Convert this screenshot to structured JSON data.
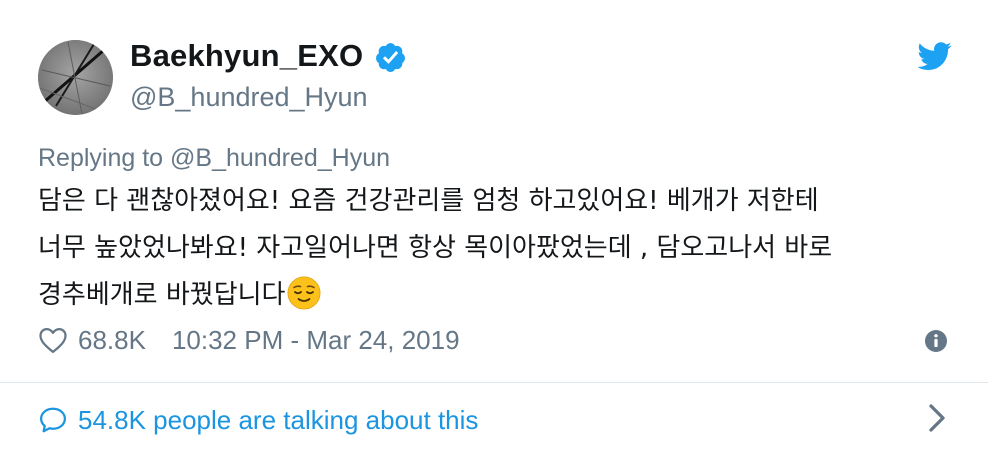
{
  "user": {
    "display_name": "Baekhyun_EXO",
    "handle": "@B_hundred_Hyun",
    "verified_icon": "verified-badge-icon"
  },
  "brand": {
    "logo_icon": "twitter-bird-icon",
    "color": "#1da1f2"
  },
  "reply": {
    "prefix": "Replying to",
    "mention": "@B_hundred_Hyun"
  },
  "tweet": {
    "lines": [
      "담은 다 괜찮아졌어요! 요즘 건강관리를 엄청 하고있어요! 베개가 저한테",
      "너무 높았었나봐요! 자고일어나면 항상 목이아팠었는데 , 담오고나서 바로",
      "경추베개로 바꿨답니다"
    ],
    "emoji": "relieved-face-emoji"
  },
  "meta": {
    "likes": "68.8K",
    "timestamp": "10:32 PM - Mar 24, 2019",
    "heart_icon": "heart-outline-icon",
    "info_icon": "info-icon"
  },
  "footer": {
    "talking_label": "54.8K people are talking about this",
    "bubble_icon": "speech-bubble-icon",
    "chevron_icon": "chevron-right-icon"
  },
  "colors": {
    "text": "#14171a",
    "secondary": "#657786",
    "link": "#1b95e0",
    "divider": "#e1e8ed"
  }
}
